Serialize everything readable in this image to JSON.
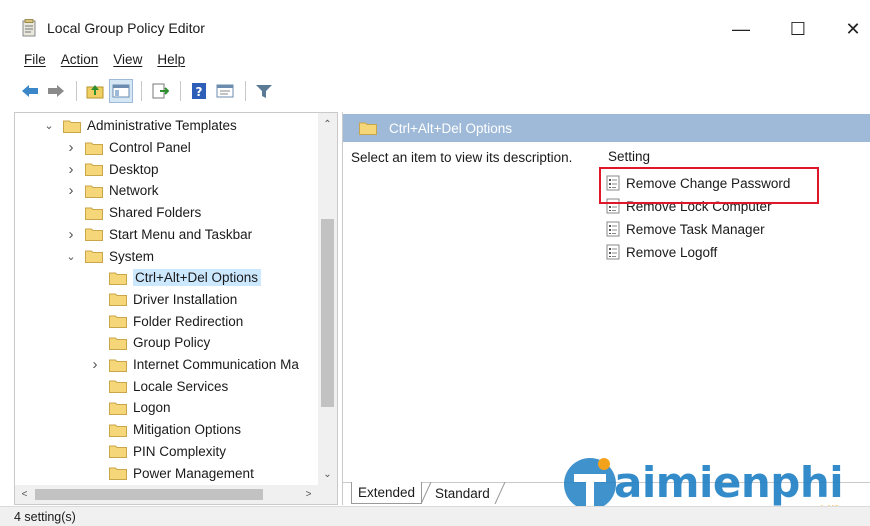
{
  "window": {
    "title": "Local Group Policy Editor",
    "controls": [
      "—",
      "☐",
      "✕"
    ]
  },
  "menu": {
    "items": [
      "File",
      "Action",
      "View",
      "Help"
    ]
  },
  "toolbar": {
    "buttons": [
      "back-arrow-icon",
      "forward-arrow-icon",
      "up-folder-icon",
      "show-hide-tree-icon",
      "export-list-icon",
      "help-icon",
      "properties-icon",
      "filter-icon"
    ]
  },
  "tree": {
    "root": "Administrative Templates",
    "items": [
      "Control Panel",
      "Desktop",
      "Network",
      "Shared Folders",
      "Start Menu and Taskbar",
      "System",
      "Ctrl+Alt+Del Options",
      "Driver Installation",
      "Folder Redirection",
      "Group Policy",
      "Internet Communication Ma",
      "Locale Services",
      "Logon",
      "Mitigation Options",
      "PIN Complexity",
      "Power Management"
    ],
    "selected": "Ctrl+Alt+Del Options"
  },
  "details": {
    "header_title": "Ctrl+Alt+Del Options",
    "description": "Select an item to view its description.",
    "column_header": "Setting",
    "settings": [
      "Remove Change Password",
      "Remove Lock Computer",
      "Remove Task Manager",
      "Remove Logoff"
    ],
    "highlighted_setting": "Remove Change Password"
  },
  "tabs": [
    "Extended",
    "Standard"
  ],
  "status": "4 setting(s)",
  "watermark": {
    "brand": "aimienphi",
    "suffix": ".vn"
  },
  "colors": {
    "header_blue": "#9fbad8",
    "selection": "#cce8ff",
    "highlight_red": "#e0162b",
    "folder_yellow": "#f5d77a",
    "watermark_blue": "#1f7fc4",
    "watermark_orange": "#f3a21b"
  }
}
